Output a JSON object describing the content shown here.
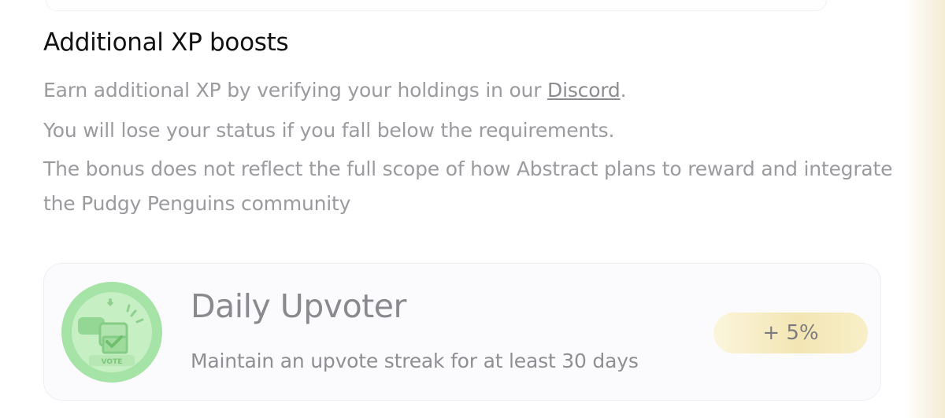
{
  "section": {
    "heading": "Additional XP boosts",
    "line1_prefix": "Earn additional XP by verifying your holdings in our ",
    "line1_link": "Discord",
    "line1_suffix": ".",
    "line2": "You will lose your status if you fall below the requirements.",
    "line3": "The bonus does not reflect the full scope of how Abstract plans to reward and integrate the Pudgy Penguins community"
  },
  "boost_card": {
    "badge_icon": "vote-badge-icon",
    "badge_text": "VOTE",
    "title": "Daily Upvoter",
    "description": "Maintain an upvote streak for at least 30 days",
    "bonus": "+ 5%",
    "colors": {
      "badge_green": "#a6e3a6",
      "pill_gold": "#f3e6b4"
    }
  }
}
